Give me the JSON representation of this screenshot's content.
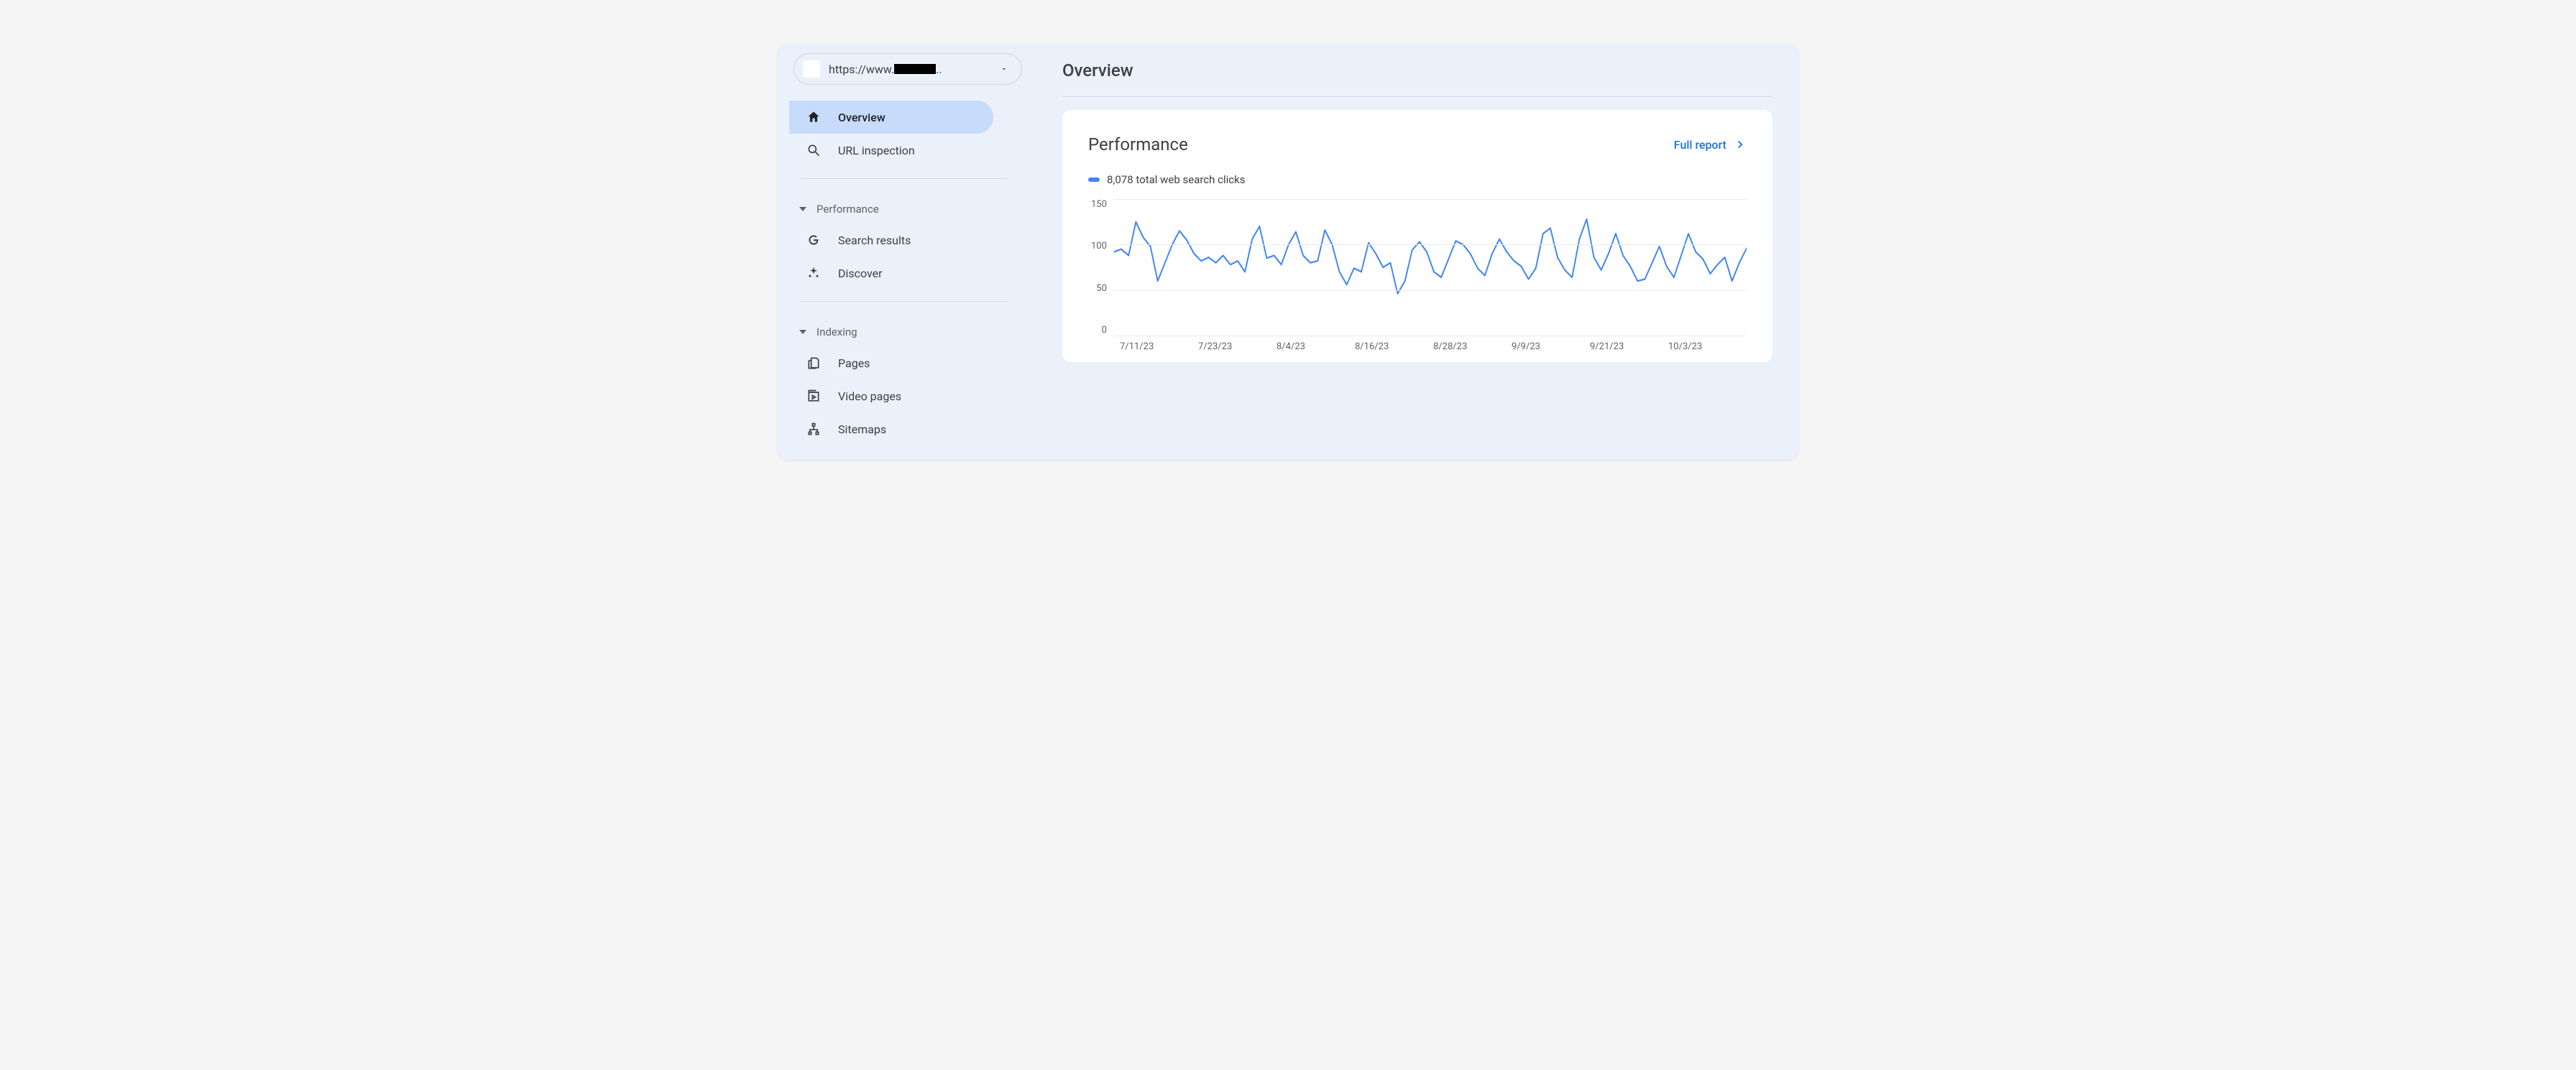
{
  "property": {
    "url_prefix": "https://www.",
    "url_redacted": true
  },
  "sidebar": {
    "items": {
      "overview": "Overview",
      "url_inspection": "URL inspection",
      "search_results": "Search results",
      "discover": "Discover",
      "pages": "Pages",
      "video_pages": "Video pages",
      "sitemaps": "Sitemaps"
    },
    "sections": {
      "performance": "Performance",
      "indexing": "Indexing"
    }
  },
  "main": {
    "page_title": "Overview",
    "card_title": "Performance",
    "full_report": "Full report",
    "legend": "8,078 total web search clicks"
  },
  "chart_data": {
    "type": "line",
    "title": "Performance",
    "ylabel": "",
    "xlabel": "",
    "ylim": [
      0,
      150
    ],
    "y_ticks": [
      150,
      100,
      50,
      0
    ],
    "x_ticks": [
      "7/11/23",
      "7/23/23",
      "8/4/23",
      "8/16/23",
      "8/28/23",
      "9/9/23",
      "9/21/23",
      "10/3/23"
    ],
    "series": [
      {
        "name": "total web search clicks",
        "total": 8078,
        "values": [
          92,
          95,
          88,
          125,
          108,
          98,
          60,
          80,
          100,
          115,
          105,
          90,
          82,
          86,
          80,
          88,
          78,
          82,
          70,
          106,
          120,
          85,
          88,
          78,
          100,
          114,
          88,
          80,
          82,
          116,
          100,
          70,
          56,
          74,
          70,
          102,
          90,
          75,
          80,
          46,
          60,
          94,
          103,
          92,
          70,
          64,
          84,
          104,
          100,
          90,
          74,
          66,
          90,
          106,
          92,
          82,
          76,
          62,
          74,
          112,
          118,
          86,
          72,
          64,
          106,
          128,
          86,
          72,
          90,
          112,
          88,
          76,
          60,
          62,
          80,
          98,
          76,
          64,
          88,
          112,
          92,
          84,
          68,
          78,
          86,
          60,
          80,
          96
        ]
      }
    ]
  }
}
